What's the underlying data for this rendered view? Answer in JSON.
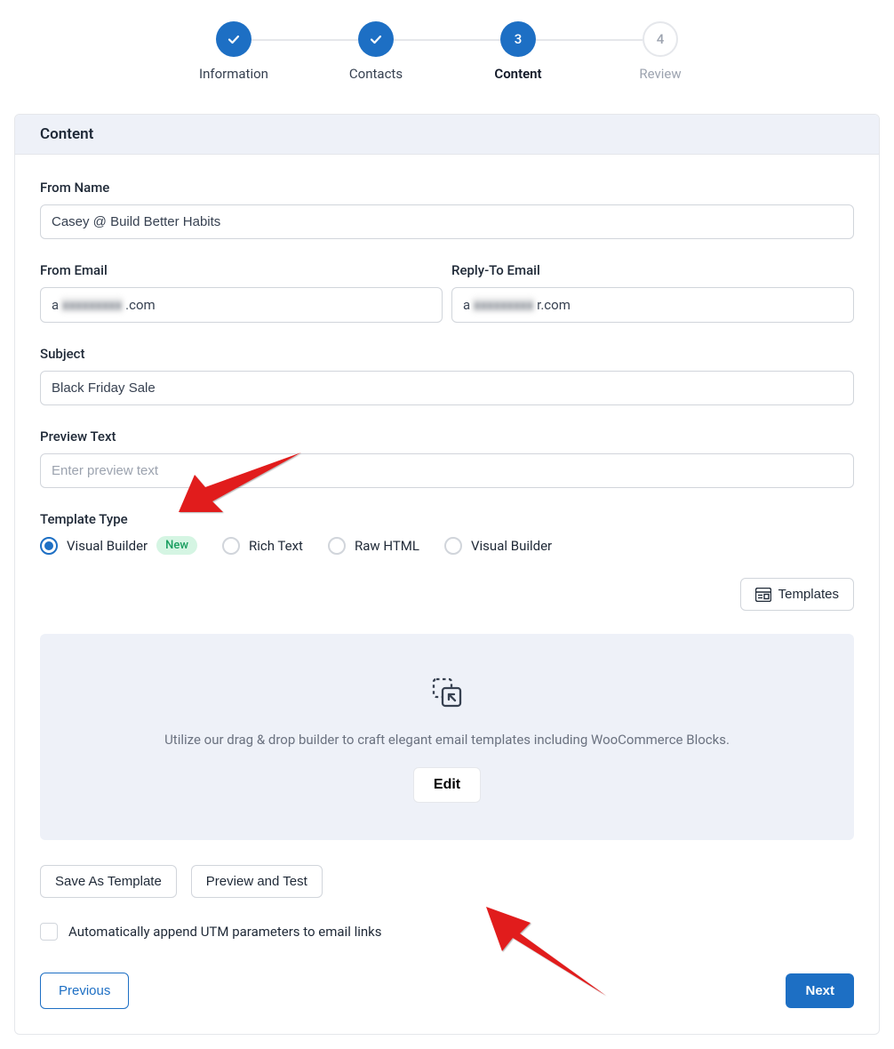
{
  "stepper": {
    "steps": [
      {
        "label": "Information",
        "state": "done"
      },
      {
        "label": "Contacts",
        "state": "done"
      },
      {
        "label": "Content",
        "state": "active",
        "number": "3"
      },
      {
        "label": "Review",
        "state": "pending",
        "number": "4"
      }
    ]
  },
  "header": {
    "title": "Content"
  },
  "form": {
    "from_name": {
      "label": "From Name",
      "value": "Casey @ Build Better Habits"
    },
    "from_email": {
      "label": "From Email",
      "prefix": "a",
      "suffix": ".com"
    },
    "reply_to_email": {
      "label": "Reply-To Email",
      "prefix": "a",
      "suffix": "r.com"
    },
    "subject": {
      "label": "Subject",
      "value": "Black Friday Sale"
    },
    "preview_text": {
      "label": "Preview Text",
      "placeholder": "Enter preview text",
      "value": ""
    },
    "template_type": {
      "label": "Template Type",
      "options": [
        {
          "label": "Visual Builder",
          "selected": true,
          "badge": "New"
        },
        {
          "label": "Rich Text",
          "selected": false
        },
        {
          "label": "Raw HTML",
          "selected": false
        },
        {
          "label": "Visual Builder",
          "selected": false
        }
      ]
    }
  },
  "templates_button": "Templates",
  "builder": {
    "text": "Utilize our drag & drop builder to craft elegant email templates including WooCommerce Blocks.",
    "edit": "Edit"
  },
  "actions": {
    "save_template": "Save As Template",
    "preview_test": "Preview and Test"
  },
  "utm_checkbox": {
    "label": "Automatically append UTM parameters to email links",
    "checked": false
  },
  "nav": {
    "previous": "Previous",
    "next": "Next"
  }
}
